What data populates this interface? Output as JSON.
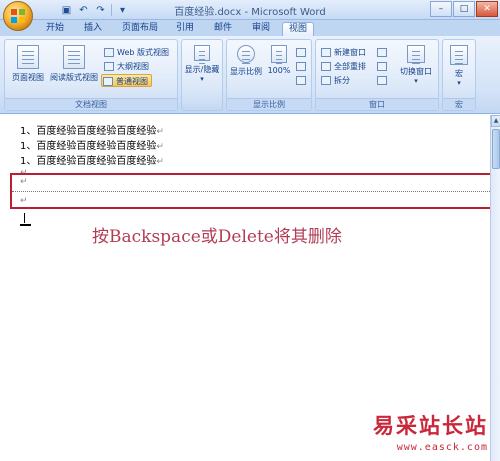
{
  "window": {
    "title": "百度经验.docx - Microsoft Word",
    "minimize": "–",
    "maximize": "□",
    "close": "✕"
  },
  "qat": {
    "save_icon": "save-icon",
    "undo_icon": "undo-icon",
    "redo_icon": "redo-icon"
  },
  "tabs": [
    {
      "label": "开始"
    },
    {
      "label": "插入"
    },
    {
      "label": "页面布局"
    },
    {
      "label": "引用"
    },
    {
      "label": "邮件"
    },
    {
      "label": "审阅"
    },
    {
      "label": "视图"
    }
  ],
  "active_tab": "视图",
  "ribbon": {
    "doc_views": {
      "label": "文档视图",
      "print_layout": "页面视图",
      "reading_layout": "阅读版式视图",
      "web_layout": "Web 版式视图",
      "outline": "大纲视图",
      "draft": "普通视图"
    },
    "show_hide": {
      "label": "显示/隐藏"
    },
    "zoom": {
      "label": "显示比例",
      "zoom_btn": "显示比例",
      "percent": "100%"
    },
    "window": {
      "label": "窗口",
      "new_window": "新建窗口",
      "arrange_all": "全部重排",
      "split": "拆分",
      "switch_windows": "切换窗口"
    },
    "macros": {
      "label": "宏",
      "macros_btn": "宏"
    }
  },
  "document": {
    "lines": [
      "1、百度经验百度经验百度经验",
      "1、百度经验百度经验百度经验",
      "1、百度经验百度经验百度经验"
    ],
    "para_mark": "↵",
    "annotation": "按Backspace或Delete将其删除"
  },
  "watermark": {
    "cn": "易采站长站",
    "url": "www.easck.com"
  },
  "colors": {
    "highlight_box": "#b82032",
    "annotation": "#b13d55",
    "watermark": "#c9273a"
  }
}
